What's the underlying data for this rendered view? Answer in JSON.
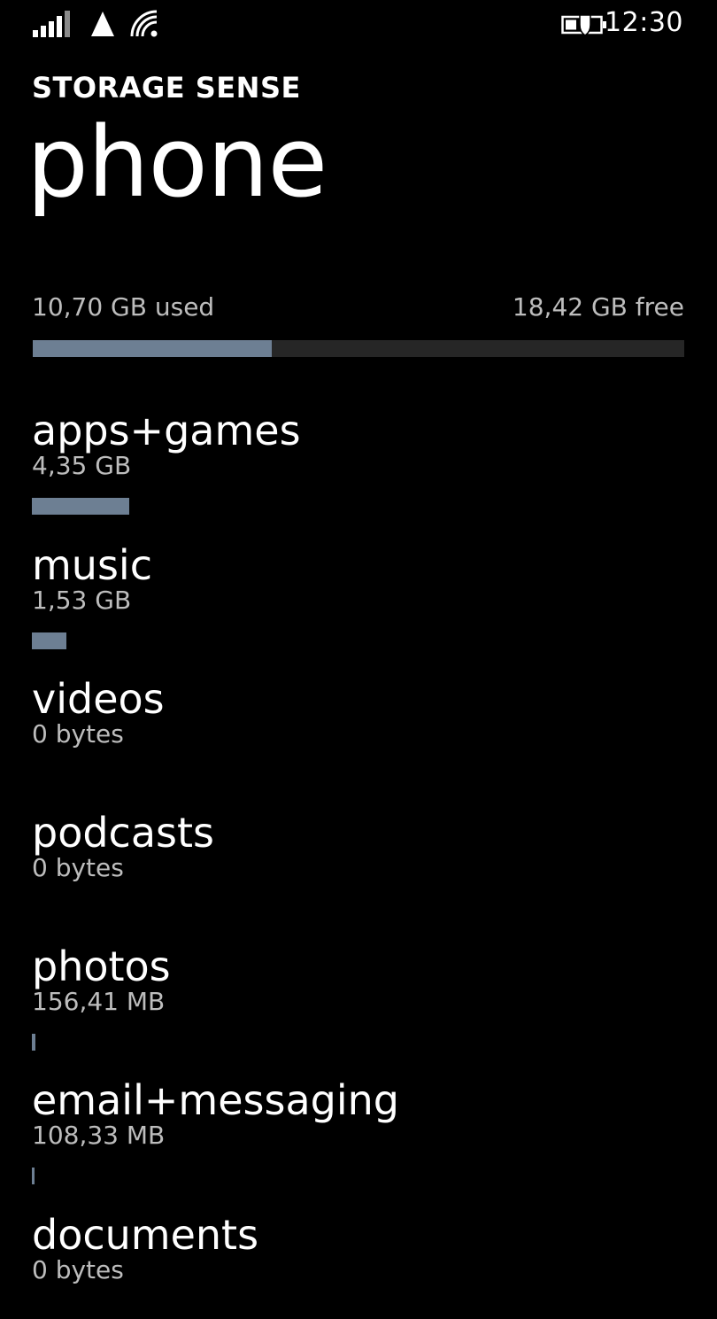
{
  "status_bar": {
    "time": "12:30",
    "icons": [
      "signal-strength-icon",
      "triangle-network-icon",
      "wifi-icon",
      "battery-saver-icon"
    ]
  },
  "header": {
    "app_title": "STORAGE SENSE",
    "page_title": "phone"
  },
  "usage": {
    "used_label": "10,70 GB used",
    "free_label": "18,42 GB free",
    "used_gb": 10.7,
    "free_gb": 18.42
  },
  "categories": [
    {
      "name": "apps+games",
      "size": "4,35 GB",
      "gb": 4.35
    },
    {
      "name": "music",
      "size": "1,53 GB",
      "gb": 1.53
    },
    {
      "name": "videos",
      "size": "0 bytes",
      "gb": 0
    },
    {
      "name": "podcasts",
      "size": "0 bytes",
      "gb": 0
    },
    {
      "name": "photos",
      "size": "156,41 MB",
      "gb": 0.15641
    },
    {
      "name": "email+messaging",
      "size": "108,33 MB",
      "gb": 0.10833
    },
    {
      "name": "documents",
      "size": "0 bytes",
      "gb": 0
    }
  ],
  "colors": {
    "background": "#000000",
    "bar_fill": "#6d7f93",
    "bar_track": "#262626",
    "secondary_text": "#bdbdbd"
  }
}
